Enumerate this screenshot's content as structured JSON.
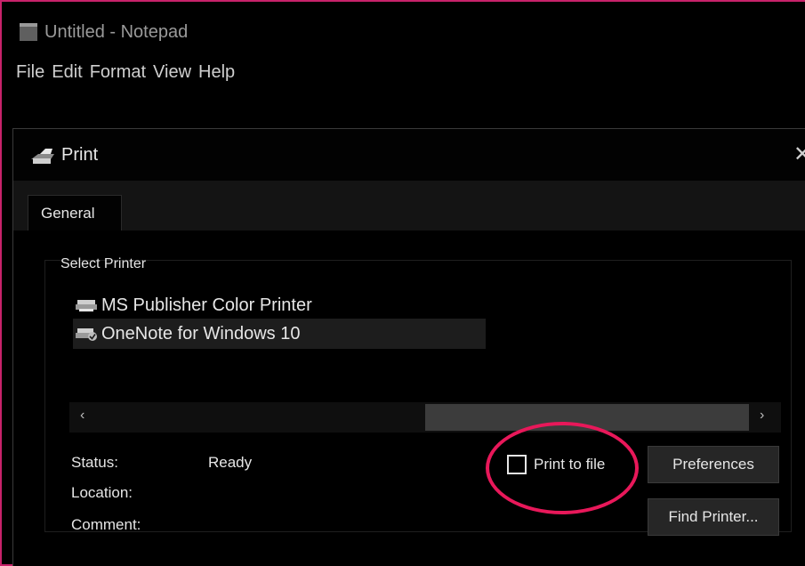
{
  "window": {
    "title": "Untitled - Notepad"
  },
  "menu": {
    "items": [
      "File",
      "Edit",
      "Format",
      "View",
      "Help"
    ]
  },
  "dialog": {
    "title": "Print",
    "close_glyph": "✕",
    "tabs": [
      {
        "label": "General",
        "selected": true
      }
    ],
    "select_printer_label": "Select Printer",
    "printers": [
      {
        "name": "MS Publisher Color Printer",
        "selected": false
      },
      {
        "name": "OneNote for Windows 10",
        "selected": true
      }
    ],
    "scroll": {
      "left_glyph": "‹",
      "right_glyph": "›"
    },
    "status_label": "Status:",
    "status_value": "Ready",
    "location_label": "Location:",
    "comment_label": "Comment:",
    "print_to_file_label": "Print to file",
    "print_to_file_checked": false,
    "preferences_label": "Preferences",
    "find_printer_label": "Find Printer..."
  },
  "annotation": {
    "color": "#e8185a"
  }
}
